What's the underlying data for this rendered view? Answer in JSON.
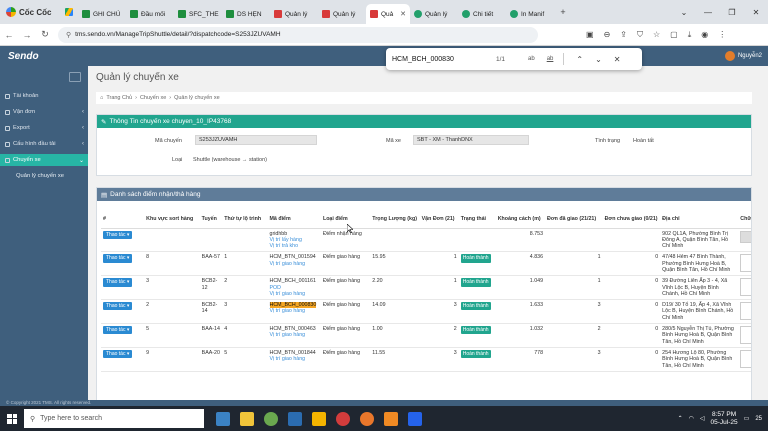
{
  "browser": {
    "brand": "Cốc Cốc",
    "tabs": [
      {
        "label": "GHI CHÚ",
        "icon": "sheet"
      },
      {
        "label": "Đầu mối",
        "icon": "sheet"
      },
      {
        "label": "SFC_THE",
        "icon": "sheet"
      },
      {
        "label": "DS HẸN",
        "icon": "sheet"
      },
      {
        "label": "Quản lý",
        "icon": "red"
      },
      {
        "label": "Quản lý",
        "icon": "red"
      },
      {
        "label": "Quả",
        "icon": "red",
        "active": true
      },
      {
        "label": "Quản lý",
        "icon": "green"
      },
      {
        "label": "Chi tiết",
        "icon": "green"
      },
      {
        "label": "In Manif",
        "icon": "green"
      }
    ],
    "url": "tms.sendo.vn/ManageTripShuttle/detail/?dispatchcode=S253JZUVAMH"
  },
  "find": {
    "query": "HCM_BCH_000830",
    "count": "1/1",
    "opt_case": "ab",
    "opt_word": "ab"
  },
  "app": {
    "logo": "Sendo",
    "user": "Nguyễn2"
  },
  "sidebar": {
    "items": [
      {
        "label": "Tài khoản"
      },
      {
        "label": "Vận đơn",
        "chev": "‹"
      },
      {
        "label": "Export",
        "chev": "‹"
      },
      {
        "label": "Cấu hình đầu tải",
        "chev": "‹"
      },
      {
        "label": "Chuyến xe",
        "chev": "⌄",
        "active": true
      }
    ],
    "sub": "Quản lý chuyến xe"
  },
  "footer": "© Copyright 2021 TMS. All rights reserved.",
  "page": {
    "title": "Quản lý chuyến xe",
    "crumbs": [
      "Trang Chủ",
      "›",
      "Chuyến xe",
      "›",
      "Quản lý chuyến xe"
    ]
  },
  "trip": {
    "header": "Thông Tin chuyến xe chuyen_10_IP43768",
    "code_label": "Mã chuyến",
    "code_value": "S253JZUVAMH",
    "vehicle_label": "Mã xe",
    "vehicle_value": "SBT - XM - ThanhDNX",
    "status_label": "Tình trạng",
    "status_value": "Hoàn tất",
    "type_label": "Loại",
    "type_value": "Shuttle (warehouse → station)"
  },
  "points": {
    "header": "Danh sách điểm nhận/thả hàng",
    "columns": [
      "#",
      "Khu vực sort hàng",
      "Tuyến",
      "Thứ tự lộ trình",
      "Mã điểm",
      "Loại điểm",
      "Trọng Lượng (kg)",
      "Vận Đơn (21)",
      "Trạng thái",
      "Khoảng cách (m)",
      "Đơn đã giao (21/21)",
      "Đơn chưa giao (0/21)",
      "Địa chỉ",
      "Chữ ký"
    ],
    "action_label": "Thao tác ▾",
    "rows": [
      {
        "sort": "",
        "route": "",
        "order": "",
        "code": "gridhbb",
        "sub1": "Vị trí lấy hàng",
        "sub2": "Vị trí trả kho",
        "type": "Điểm nhận hàng",
        "weight": "",
        "orders": "",
        "status": "",
        "distance": "8.753",
        "delivered": "",
        "pending": "",
        "address": "902 QL1A, Phường Bình Trị Đông A, Quận Bình Tân, Hồ Chí Minh",
        "sig": "gray"
      },
      {
        "sort": "8",
        "route": "BAA-57",
        "order": "1",
        "code": "HCM_BTN_001594",
        "sub1": "Vị trí giao hàng",
        "sub2": "",
        "type": "Điểm giao hàng",
        "weight": "15.95",
        "orders": "1",
        "status": "Hoàn thành",
        "distance": "4.836",
        "delivered": "1",
        "pending": "0",
        "address": "47/48 Hẻm 47 Bình Thành, Phường Bình Hưng Hoà B, Quận Bình Tân, Hồ Chí Minh",
        "sig": "box"
      },
      {
        "sort": "3",
        "route": "BCB2-12",
        "order": "2",
        "code": "HCM_BCH_001161",
        "sub1": "POD",
        "sub2": "Vị trí giao hàng",
        "type": "Điểm giao hàng",
        "weight": "2.20",
        "orders": "1",
        "status": "Hoàn thành",
        "distance": "1.049",
        "delivered": "1",
        "pending": "0",
        "address": "39 Đường Liên Ấp 3 - 4, Xã Vĩnh Lộc B, Huyện Bình Chánh, Hồ Chí Minh",
        "sig": "box"
      },
      {
        "sort": "2",
        "route": "BCB2-14",
        "order": "3",
        "code": "HCM_BCH_000830",
        "sub1": "Vị trí giao hàng",
        "sub2": "",
        "type": "Điểm giao hàng",
        "weight": "14.09",
        "orders": "3",
        "status": "Hoàn thành",
        "distance": "1.633",
        "delivered": "3",
        "pending": "0",
        "address": "D19/ 30 Tổ 19, Ấp 4, Xã Vĩnh Lộc B, Huyện Bình Chánh, Hồ Chí Minh",
        "sig": "box",
        "highlight": true
      },
      {
        "sort": "5",
        "route": "BAA-14",
        "order": "4",
        "code": "HCM_BTN_000463",
        "sub1": "Vị trí giao hàng",
        "sub2": "",
        "type": "Điểm giao hàng",
        "weight": "1.00",
        "orders": "2",
        "status": "Hoàn thành",
        "distance": "1.032",
        "delivered": "2",
        "pending": "0",
        "address": "280/5 Nguyễn Thị Tú, Phường Bình Hưng Hoà B, Quận Bình Tân, Hồ Chí Minh",
        "sig": "box"
      },
      {
        "sort": "9",
        "route": "BAA-20",
        "order": "5",
        "code": "HCM_BTN_001844",
        "sub1": "Vị trí giao hàng",
        "sub2": "",
        "type": "Điểm giao hàng",
        "weight": "11.55",
        "orders": "3",
        "status": "Hoàn thành",
        "distance": "778",
        "delivered": "3",
        "pending": "0",
        "address": "254 Hương Lộ 80, Phường Bình Hưng Hoà B, Quận Bình Tân, Hồ Chí Minh",
        "sig": "box"
      }
    ]
  },
  "taskbar": {
    "search_placeholder": "Type here to search",
    "time": "8:57 PM",
    "date": "05-Jul-25",
    "notifications": "25"
  },
  "colors": {
    "sidebar": "#3f5f7d",
    "accent_teal": "#21a58e",
    "action_blue": "#2a8ad2",
    "highlight": "#f5a623"
  }
}
